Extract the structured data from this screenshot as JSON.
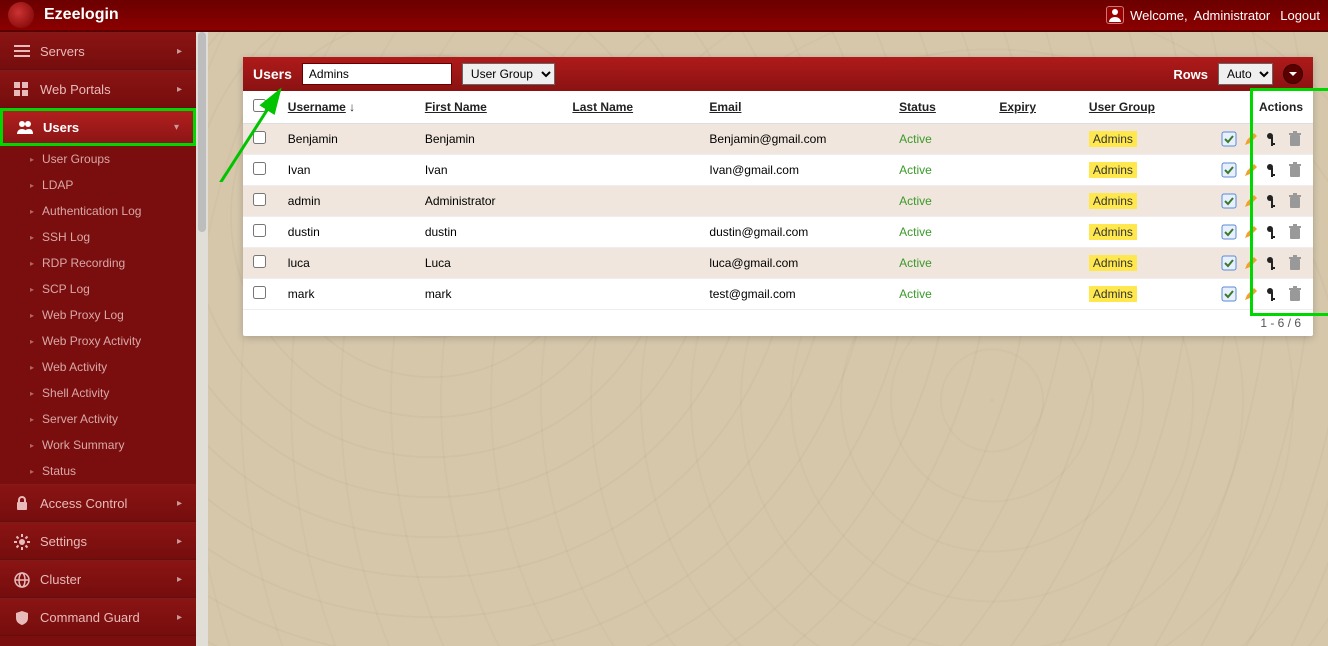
{
  "header": {
    "app_title": "Ezeelogin",
    "welcome_prefix": "Welcome, ",
    "welcome_user": "Administrator",
    "logout_label": "Logout"
  },
  "sidebar": {
    "items": [
      {
        "label": "Servers",
        "icon": "list-icon"
      },
      {
        "label": "Web Portals",
        "icon": "grid-icon"
      },
      {
        "label": "Users",
        "icon": "users-icon",
        "active": true
      },
      {
        "label": "Access Control",
        "icon": "lock-icon"
      },
      {
        "label": "Settings",
        "icon": "gear-icon"
      },
      {
        "label": "Cluster",
        "icon": "globe-icon"
      },
      {
        "label": "Command Guard",
        "icon": "shield-icon"
      }
    ],
    "users_sub": [
      "User Groups",
      "LDAP",
      "Authentication Log",
      "SSH Log",
      "RDP Recording",
      "SCP Log",
      "Web Proxy Log",
      "Web Proxy Activity",
      "Web Activity",
      "Shell Activity",
      "Server Activity",
      "Work Summary",
      "Status"
    ]
  },
  "panel": {
    "title": "Users",
    "filter_value": "Admins",
    "filter_placeholder": "",
    "filter_select": "User Group",
    "rows_label": "Rows",
    "rows_select": "Auto"
  },
  "columns": {
    "checkbox": "",
    "username": "Username",
    "sort_indicator": "↓",
    "firstname": "First Name",
    "lastname": "Last Name",
    "email": "Email",
    "status": "Status",
    "expiry": "Expiry",
    "usergroup": "User Group",
    "actions": "Actions"
  },
  "rows": [
    {
      "username": "Benjamin",
      "first": "Benjamin",
      "last": "",
      "email": "Benjamin@gmail.com",
      "status": "Active",
      "expiry": "",
      "group": "Admins"
    },
    {
      "username": "Ivan",
      "first": "Ivan",
      "last": "",
      "email": "Ivan@gmail.com",
      "status": "Active",
      "expiry": "",
      "group": "Admins"
    },
    {
      "username": "admin",
      "first": "Administrator",
      "last": "",
      "email": "",
      "status": "Active",
      "expiry": "",
      "group": "Admins"
    },
    {
      "username": "dustin",
      "first": "dustin",
      "last": "",
      "email": "dustin@gmail.com",
      "status": "Active",
      "expiry": "",
      "group": "Admins"
    },
    {
      "username": "luca",
      "first": "Luca",
      "last": "",
      "email": "luca@gmail.com",
      "status": "Active",
      "expiry": "",
      "group": "Admins"
    },
    {
      "username": "mark",
      "first": "mark",
      "last": "",
      "email": "test@gmail.com",
      "status": "Active",
      "expiry": "",
      "group": "Admins"
    }
  ],
  "pager": {
    "text": "1 - 6 / 6"
  }
}
